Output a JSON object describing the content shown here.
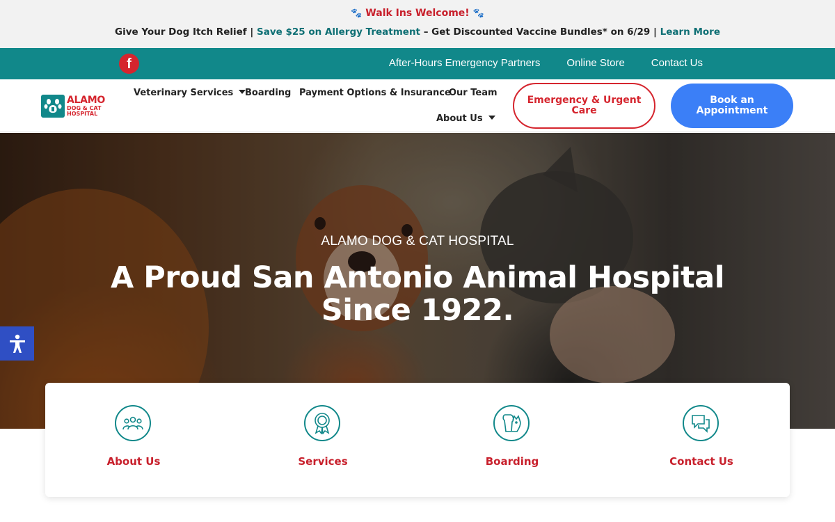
{
  "announcement": {
    "walkins": "Walk Ins Welcome!",
    "paw_icon": "🐾",
    "promo_lead": "Give Your Dog Itch Relief |",
    "promo_link": "Save $25 on Allergy Treatment",
    "promo_mid": "– Get Discounted Vaccine Bundles* on 6/29 |",
    "promo_learn": "Learn More"
  },
  "topnav": {
    "facebook_glyph": "f",
    "links": [
      "After-Hours Emergency Partners",
      "Online Store",
      "Contact Us"
    ]
  },
  "logo": {
    "line1": "ALAMO",
    "line2": "DOG & CAT",
    "line3": "HOSPITAL"
  },
  "mainnav": {
    "veterinary_services": "Veterinary Services",
    "boarding": "Boarding",
    "payment": "Payment Options & Insurance",
    "our_team": "Our Team",
    "about_us": "About Us"
  },
  "buttons": {
    "emergency": "Emergency & Urgent Care",
    "book": "Book an Appointment"
  },
  "hero": {
    "eyebrow": "ALAMO DOG & CAT HOSPITAL",
    "headline": "A Proud San Antonio Animal Hospital Since 1922."
  },
  "cards": [
    {
      "label": "About Us",
      "icon": "group-icon"
    },
    {
      "label": "Services",
      "icon": "award-badge-icon"
    },
    {
      "label": "Boarding",
      "icon": "dog-cat-icon"
    },
    {
      "label": "Contact Us",
      "icon": "chat-bubbles-icon"
    }
  ],
  "colors": {
    "teal": "#11888a",
    "red": "#d5252e",
    "blue": "#3b7ff7",
    "accessibility": "#2f4fc4"
  }
}
